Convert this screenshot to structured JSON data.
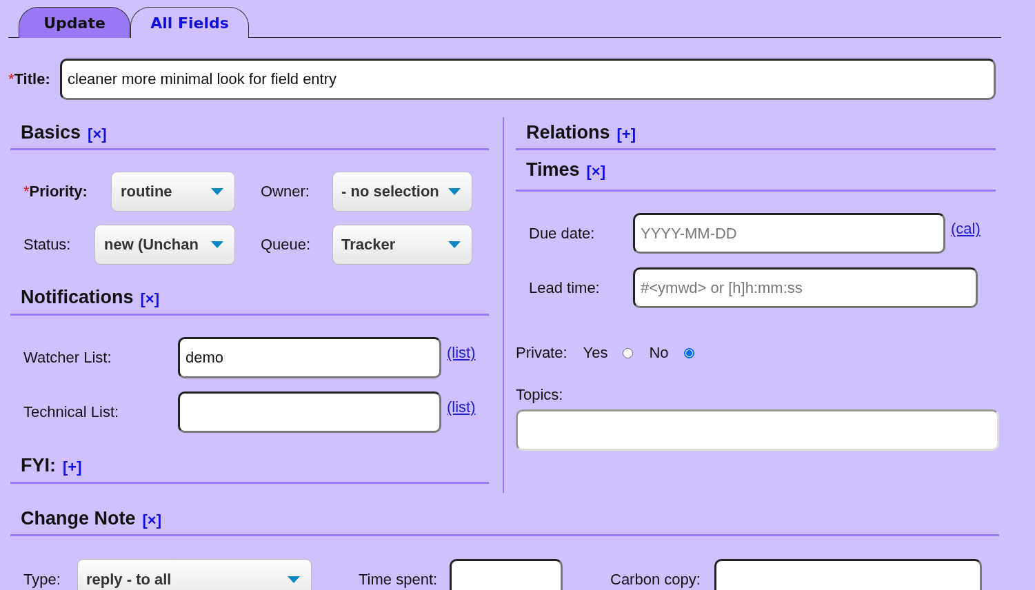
{
  "tabs": [
    {
      "label": "Update",
      "selected": true
    },
    {
      "label": "All Fields",
      "selected": false
    }
  ],
  "title": {
    "required_mark": "*",
    "label": "Title:",
    "value": "cleaner more minimal look for field entry"
  },
  "basics": {
    "heading": "Basics",
    "toggle": "[×]",
    "fields": [
      {
        "required_mark": "*",
        "label": "Priority:",
        "value": "routine"
      },
      {
        "label": "Owner:",
        "value": "- no selection"
      },
      {
        "label": "Status:",
        "value": "new (Unchan"
      },
      {
        "label": "Queue:",
        "value": "Tracker"
      }
    ]
  },
  "notifications": {
    "heading": "Notifications",
    "toggle": "[×]",
    "fields": [
      {
        "label": "Watcher List:",
        "value": "demo",
        "link": "(list)"
      },
      {
        "label": "Technical List:",
        "link": "(list)"
      }
    ]
  },
  "fyi": {
    "heading": "FYI:",
    "toggle": "[+]"
  },
  "relations": {
    "heading": "Relations",
    "toggle": "[+]"
  },
  "times": {
    "heading": "Times",
    "toggle": "[×]",
    "fields": [
      {
        "label": "Due date:",
        "placeholder": "YYYY-MM-DD",
        "link": "(cal)"
      },
      {
        "label": "Lead time:",
        "placeholder": "#<ymwd> or [h]h:mm:ss"
      }
    ]
  },
  "private": {
    "label": "Private:",
    "options": [
      {
        "label": "Yes",
        "selected": false
      },
      {
        "label": "No",
        "selected": true
      }
    ]
  },
  "topics": {
    "label": "Topics:"
  },
  "change_note": {
    "heading": "Change Note",
    "toggle": "[×]",
    "fields": [
      {
        "kind": "select",
        "label": "Type:",
        "value": "reply - to all"
      },
      {
        "kind": "input",
        "label": "Time spent:"
      },
      {
        "kind": "input",
        "label": "Carbon copy:"
      }
    ]
  }
}
